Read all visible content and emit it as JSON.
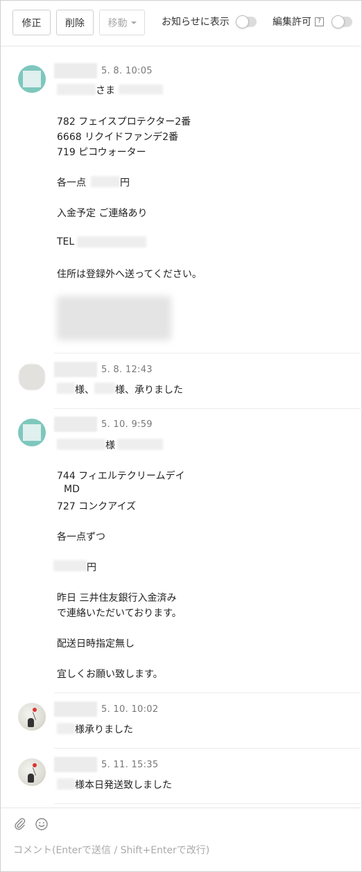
{
  "toolbar": {
    "edit_label": "修正",
    "delete_label": "削除",
    "move_label": "移動",
    "notice_label": "お知らせに表示",
    "edit_permission_label": "編集許可",
    "help_glyph": "?"
  },
  "comments": [
    {
      "timestamp": "5. 8. 10:05",
      "greeting_suffix": "さま",
      "lines": [
        "782 フェイスプロテクター2番",
        "6668 リクイドファンデ2番",
        "719 ピコウォーター",
        "円",
        "入金予定 ご連絡あり",
        "TEL",
        "住所は登録外へ送ってください。"
      ],
      "each_prefix": "各一点"
    },
    {
      "timestamp": "5. 8. 12:43",
      "sama1": "様、",
      "sama2": "様、承りました"
    },
    {
      "timestamp": "5. 10. 9:59",
      "greeting_suffix": "様",
      "lines": [
        "744 フィエルテクリームデイ",
        "MD",
        "727 コンクアイズ",
        "各一点ずつ",
        "円",
        "昨日 三井住友銀行入金済み",
        "で連絡いただいております。",
        "配送日時指定無し",
        "宜しくお願い致します。"
      ]
    },
    {
      "timestamp": "5. 10. 10:02",
      "text": "様承りました"
    },
    {
      "timestamp": "5. 11. 15:35",
      "text": "様本日発送致しました"
    }
  ],
  "composer": {
    "placeholder": "コメント(Enterで送信 / Shift+Enterで改行)",
    "attach_icon": "paperclip-icon",
    "emoji_icon": "smiley-icon"
  },
  "colors": {
    "avatar_teal": "#7ec7bd",
    "toggle_off": "#dcdcdc"
  }
}
